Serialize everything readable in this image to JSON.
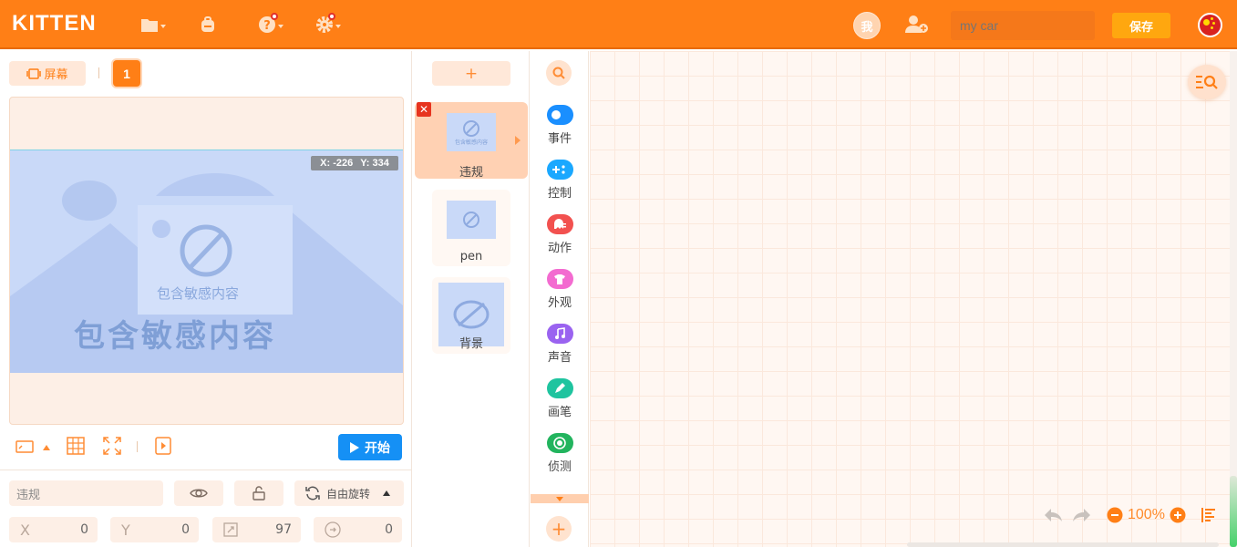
{
  "header": {
    "logo": "KITTEN",
    "user_badge": "我",
    "search_placeholder": "my car",
    "save_label": "保存",
    "icons": [
      "folder-icon",
      "backpack-icon",
      "help-icon",
      "settings-icon",
      "add-user-icon",
      "language-flag-icon"
    ]
  },
  "stage": {
    "screen_label": "屏幕",
    "page_number": "1",
    "coord_x": "X: -226",
    "coord_y": "Y: 334",
    "watermark_small": "包含敏感内容",
    "watermark_big": "包含敏感内容",
    "start_label": "开始"
  },
  "sprite_props": {
    "name": "违规",
    "rotation_label": "自由旋转",
    "x_label": "X",
    "x_value": "0",
    "y_label": "Y",
    "y_value": "0",
    "size_value": "97",
    "direction_value": "0"
  },
  "sprites": {
    "add_label": "+",
    "items": [
      {
        "label": "违规",
        "selected": true,
        "thumb_text": "包含敏感内容"
      },
      {
        "label": "pen",
        "selected": false,
        "thumb_text": ""
      },
      {
        "label": "背景",
        "selected": false,
        "thumb_text": ""
      }
    ]
  },
  "categories": [
    {
      "label": "事件",
      "color": "#1a8fff"
    },
    {
      "label": "控制",
      "color": "#1aa8ff"
    },
    {
      "label": "动作",
      "color": "#f2514f"
    },
    {
      "label": "外观",
      "color": "#f36bd0"
    },
    {
      "label": "声音",
      "color": "#9a63f0"
    },
    {
      "label": "画笔",
      "color": "#1fc49f"
    },
    {
      "label": "侦测",
      "color": "#22b45e"
    }
  ],
  "workspace": {
    "zoom": "100%"
  },
  "colors": {
    "accent": "#ff7f16",
    "start": "#1590f5",
    "save": "#ffa70f"
  }
}
